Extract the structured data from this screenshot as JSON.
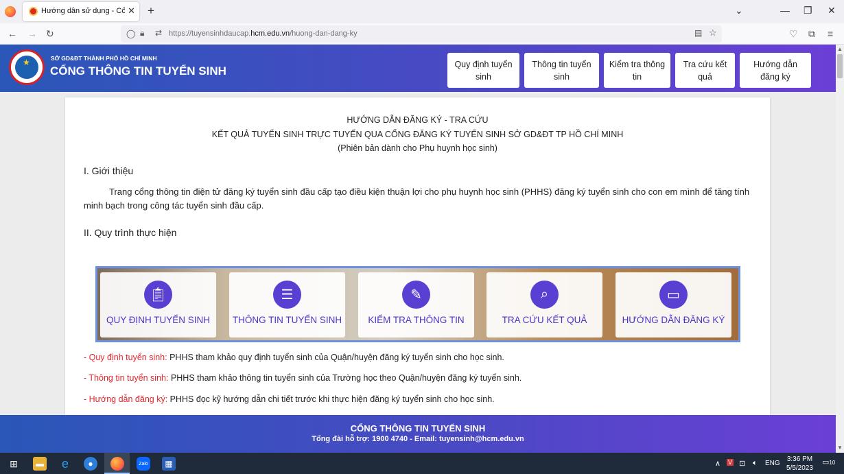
{
  "browser": {
    "tab_title": "Hướng dẫn sử dụng - Cổng thông tin",
    "url_prefix": "https://tuyensinhdaucap.",
    "url_domain": "hcm.edu.vn",
    "url_path": "/huong-dan-dang-ky"
  },
  "header": {
    "org_sub": "SỞ GD&ĐT THÀNH PHỐ HỒ CHÍ MINH",
    "org_title": "CỔNG THÔNG TIN TUYỂN SINH",
    "nav": [
      {
        "label": "Quy định tuyển sinh"
      },
      {
        "label": "Thông tin tuyển sinh"
      },
      {
        "label": "Kiểm tra thông tin"
      },
      {
        "label": "Tra cứu kết quả"
      },
      {
        "label": "Hướng dẫn đăng ký"
      }
    ]
  },
  "content": {
    "title1": "HƯỚNG DẪN ĐĂNG KÝ  - TRA CỨU",
    "title2": "KẾT QUẢ TUYỂN SINH TRỰC TUYẾN QUA CỔNG ĐĂNG KÝ TUYỂN SINH SỞ GD&ĐT TP HỒ CHÍ MINH",
    "title3": "(Phiên bản dành cho Phụ huynh học sinh)",
    "section1": "I. Giới thiệu",
    "intro": "Trang cổng thông tin điện tử đăng ký tuyển sinh đầu cấp tạo điều kiện thuận lợi cho phụ huynh học sinh (PHHS) đăng ký tuyển sinh cho con em mình để tăng tính minh bạch trong công tác tuyển sinh đầu cấp.",
    "section2": "II. Quy trình thực hiện",
    "steps": [
      {
        "label": "QUY ĐỊNH TUYỂN SINH",
        "icon": "clipboard-check-icon"
      },
      {
        "label": "THÔNG TIN TUYỂN SINH",
        "icon": "notepad-icon"
      },
      {
        "label": "KIỂM TRA THÔNG TIN",
        "icon": "edit-document-icon"
      },
      {
        "label": "TRA CỨU KẾT QUẢ",
        "icon": "search-document-icon"
      },
      {
        "label": "HƯỚNG DẪN ĐĂNG KÝ",
        "icon": "laptop-icon"
      }
    ],
    "notes": [
      {
        "key": "- Quy định tuyển sinh:",
        "text": " PHHS tham khảo quy định tuyển sinh của Quận/huyện đăng ký tuyển sinh cho học sinh."
      },
      {
        "key": "- Thông tin tuyển sinh:",
        "text": " PHHS tham khảo thông tin tuyển sinh của Trường học theo Quận/huyện đăng ký tuyển sinh."
      },
      {
        "key": "- Hướng dẫn đăng ký:",
        "text": " PHHS đọc kỹ hướng dẫn chi tiết trước khi thực hiện đăng ký tuyển sinh cho học sinh."
      }
    ]
  },
  "footer": {
    "title": "CỔNG THÔNG TIN TUYỂN SINH",
    "contact": "Tổng đài hỗ trợ: 1900 4740 - Email: tuyensinh@hcm.edu.vn"
  },
  "taskbar": {
    "lang": "ENG",
    "time": "3:36 PM",
    "date": "5/5/2023",
    "notif_count": "10"
  },
  "colors": {
    "header_start": "#2a57b8",
    "header_end": "#6b3fd6",
    "accent_purple": "#4a35c8",
    "note_red": "#e3262b"
  }
}
